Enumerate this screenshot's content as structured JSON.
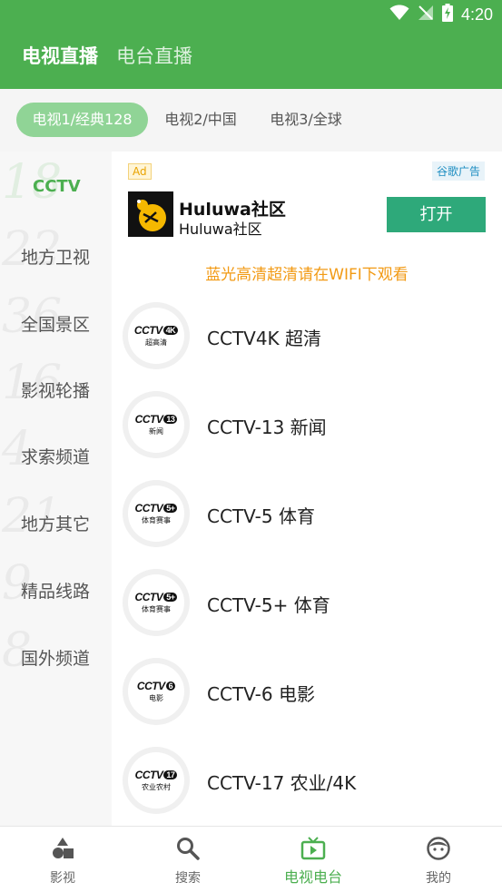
{
  "status_bar": {
    "time": "4:20",
    "icons": [
      "wifi-icon",
      "signal-off-icon",
      "battery-charging-icon"
    ]
  },
  "header": {
    "tabs": [
      {
        "label": "电视直播",
        "active": true
      },
      {
        "label": "电台直播",
        "active": false
      }
    ]
  },
  "subtabs": [
    {
      "label": "电视1/经典128",
      "active": true
    },
    {
      "label": "电视2/中国",
      "active": false
    },
    {
      "label": "电视3/全球",
      "active": false
    }
  ],
  "categories": [
    {
      "label": "CCTV",
      "num": "18",
      "active": true
    },
    {
      "label": "地方卫视",
      "num": "22"
    },
    {
      "label": "全国景区",
      "num": "36"
    },
    {
      "label": "影视轮播",
      "num": "16"
    },
    {
      "label": "求索频道",
      "num": "4"
    },
    {
      "label": "地方其它",
      "num": "21"
    },
    {
      "label": "精品线路",
      "num": "9"
    },
    {
      "label": "国外频道",
      "num": "8"
    }
  ],
  "ad": {
    "badge": "Ad",
    "provider_label": "谷歌广告",
    "title": "Huluwa社区",
    "subtitle": "Huluwa社区",
    "button_label": "打开"
  },
  "notice": "蓝光高清超清请在WIFI下观看",
  "channels": [
    {
      "name": "CCTV4K 超清",
      "logo_number": "4K",
      "logo_sub": "超高清"
    },
    {
      "name": "CCTV-13 新闻",
      "logo_number": "13",
      "logo_sub": "新闻"
    },
    {
      "name": "CCTV-5 体育",
      "logo_number": "5+",
      "logo_sub": "体育赛事"
    },
    {
      "name": "CCTV-5+ 体育",
      "logo_number": "5+",
      "logo_sub": "体育赛事"
    },
    {
      "name": "CCTV-6 电影",
      "logo_number": "6",
      "logo_sub": "电影"
    },
    {
      "name": "CCTV-17 农业/4K",
      "logo_number": "17",
      "logo_sub": "农业农村"
    }
  ],
  "logo_brand": "CCTV",
  "bottom_nav": [
    {
      "label": "影视",
      "icon": "shapes-icon"
    },
    {
      "label": "搜索",
      "icon": "search-icon"
    },
    {
      "label": "电视电台",
      "icon": "tv-icon",
      "active": true
    },
    {
      "label": "我的",
      "icon": "face-icon"
    }
  ],
  "colors": {
    "primary": "#4caf50",
    "subtab_active": "#90d496",
    "ad_button": "#2ea97a",
    "notice": "#f29a14"
  }
}
